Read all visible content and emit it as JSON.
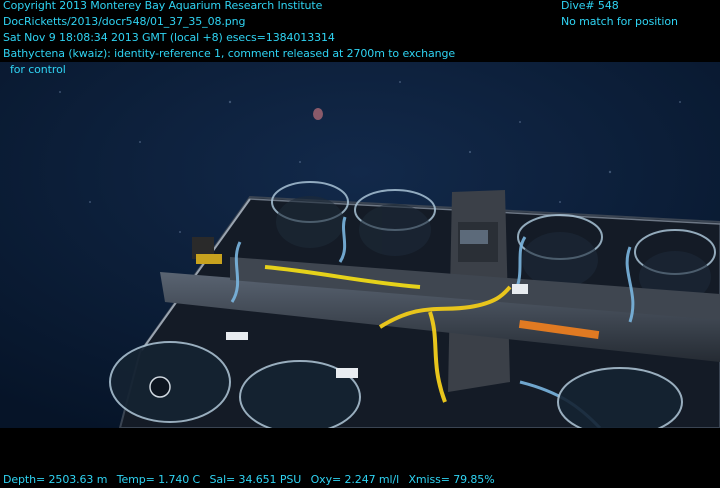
{
  "overlay": {
    "header_lines": [
      "Copyright 2013 Monterey Bay Aquarium Research Institute",
      "DocRicketts/2013/docr548/01_37_35_08.png",
      "Sat Nov  9 18:08:34 2013 GMT (local +8)  esecs=1384013314",
      "Bathyctena (kwaiz): identity-reference 1, comment released at 2700m to exchange",
      "for control"
    ],
    "dive_label": "Dive# 548",
    "position_status": "No match for position",
    "telemetry": {
      "depth": "Depth= 2503.63 m",
      "temp": "Temp= 1.740 C",
      "salinity": "Sal= 34.651 PSU",
      "oxygen": "Oxy= 2.247 ml/l",
      "xmiss": "Xmiss= 79.85%"
    },
    "text_color": "#2fd3f2"
  },
  "scene": {
    "subject": "ROV sampling drawer with clear plastic specimen canisters on the deep seafloor",
    "water_color": "#0b1e38"
  }
}
